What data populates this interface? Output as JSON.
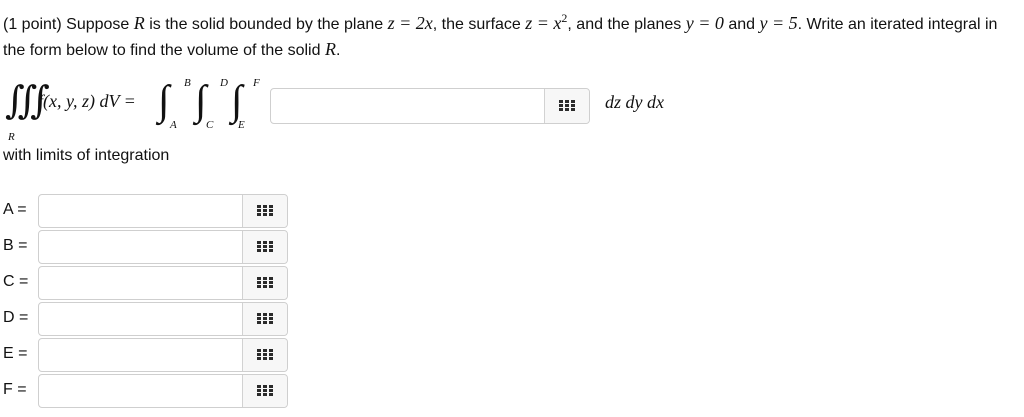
{
  "problem": {
    "prefix": "(1 point) Suppose",
    "R": "R",
    "t1": "is the solid bounded by the plane",
    "plane_eq": "z = 2x",
    "t2": ", the surface",
    "surface_eq": "z = x",
    "surface_exp": "2",
    "t3": ", and the planes",
    "y0_eq": "y = 0",
    "t4": "and",
    "y5_eq": "y = 5",
    "t5": ". Write an iterated integral in the form below to find the volume of the solid",
    "R2": "R",
    "t6": "."
  },
  "formula": {
    "triple_integral": "∭",
    "region": "R",
    "integrand": "f(x, y, z) dV =",
    "integral_sign": "∫",
    "upper_limits": [
      "B",
      "D",
      "F"
    ],
    "lower_limits": [
      "A",
      "C",
      "E"
    ],
    "answer_value": "",
    "differentials": "dz dy dx"
  },
  "limits_heading": "with limits of integration",
  "limits": [
    {
      "label": "A =",
      "value": ""
    },
    {
      "label": "B =",
      "value": ""
    },
    {
      "label": "C =",
      "value": ""
    },
    {
      "label": "D =",
      "value": ""
    },
    {
      "label": "E =",
      "value": ""
    },
    {
      "label": "F =",
      "value": ""
    }
  ],
  "icons": {
    "palette": "keypad-grid-icon"
  },
  "colors": {
    "text": "#111111",
    "border": "#cfcfcf",
    "button_bg": "#f7f7f7",
    "icon": "#2b2b2b"
  }
}
